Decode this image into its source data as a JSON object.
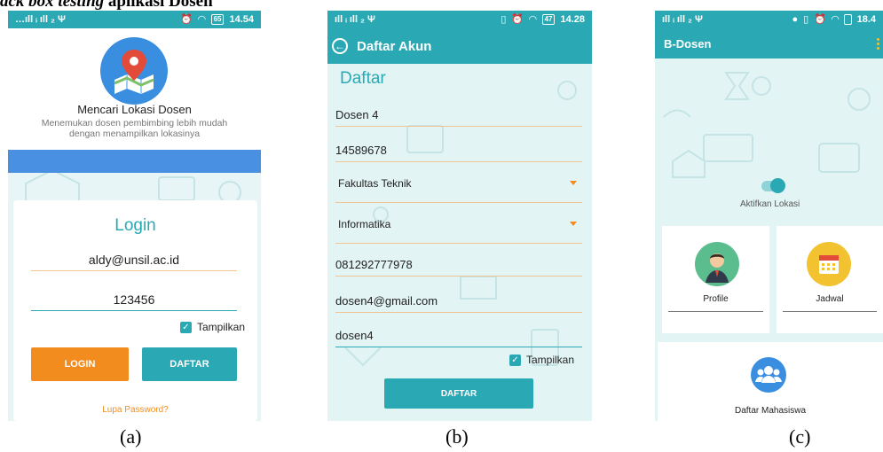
{
  "figure": {
    "caption_bold_italic": "ack box testing",
    "caption_bold": " aplikasi Dosen",
    "labels": [
      "(a)",
      "(b)",
      "(c)"
    ]
  },
  "screen_a": {
    "status": {
      "signal": "…ıll ᵢ ıll ₂ Ψ",
      "battery": "65",
      "time": "14.54"
    },
    "app_title": "Mencari Lokasi Dosen",
    "app_subtitle_line1": "Menemukan dosen pembimbing lebih mudah",
    "app_subtitle_line2": "dengan menampilkan lokasinya",
    "login_title": "Login",
    "email_value": "aldy@unsil.ac.id",
    "password_value": "123456",
    "show_label": "Tampilkan",
    "login_button": "LOGIN",
    "daftar_button": "DAFTAR",
    "forgot_link": "Lupa Password?"
  },
  "screen_b": {
    "status": {
      "signal": "ıll ᵢ ıll ₂ Ψ",
      "battery": "47",
      "time": "14.28"
    },
    "appbar_title": "Daftar Akun",
    "heading": "Daftar",
    "name_value": "Dosen 4",
    "nip_value": "14589678",
    "fakultas_value": "Fakultas Teknik",
    "prodi_value": "Informatika",
    "phone_value": "081292777978",
    "email_value": "dosen4@gmail.com",
    "password_value": "dosen4",
    "show_label": "Tampilkan",
    "daftar_button": "DAFTAR"
  },
  "screen_c": {
    "status": {
      "signal": "ıll ᵢ ıll ₂ Ψ",
      "time": "18.4"
    },
    "appbar_title": "B-Dosen",
    "toggle_label": "Aktifkan Lokasi",
    "toggle_on": true,
    "tile_profile": "Profile",
    "tile_jadwal": "Jadwal",
    "tile_mahasiswa": "Daftar Mahasiswa"
  },
  "colors": {
    "primary": "#2aa9b4",
    "accent": "#f28c1e",
    "band_blue": "#4a90e2",
    "background": "#e3f4f4"
  }
}
